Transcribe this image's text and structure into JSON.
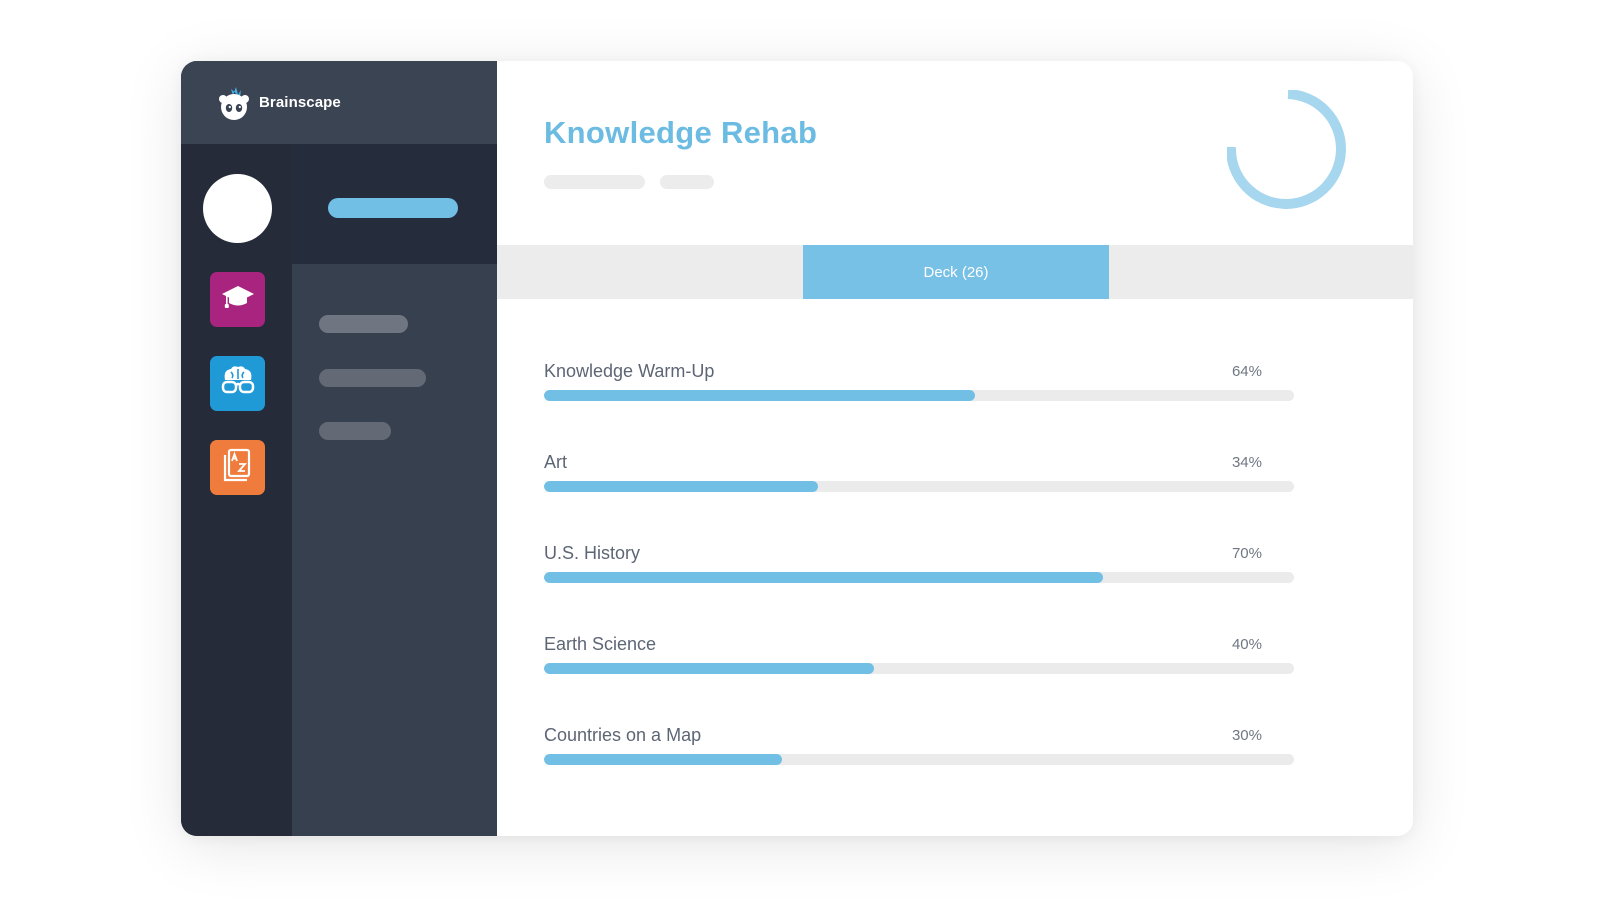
{
  "brand": {
    "name": "Brainscape"
  },
  "nav": {
    "items": [
      {
        "icon": "graduation-cap-icon",
        "color": "#a8247e"
      },
      {
        "icon": "brain-glasses-icon",
        "color": "#1f9ad6"
      },
      {
        "icon": "a-z-book-icon",
        "color": "#ef7c3c"
      }
    ]
  },
  "main": {
    "title": "Knowledge Rehab",
    "tab_label": "Deck (26)",
    "accent_color": "#72bfe6",
    "progress_ring": {
      "icon": "progress-ring-icon"
    },
    "subjects": [
      {
        "name": "Knowledge Warm-Up",
        "percent_label": "64%",
        "progress": 0.575
      },
      {
        "name": "Art",
        "percent_label": "34%",
        "progress": 0.365
      },
      {
        "name": "U.S. History",
        "percent_label": "70%",
        "progress": 0.745
      },
      {
        "name": "Earth Science",
        "percent_label": "40%",
        "progress": 0.44
      },
      {
        "name": "Countries on a Map",
        "percent_label": "30%",
        "progress": 0.317
      }
    ]
  }
}
